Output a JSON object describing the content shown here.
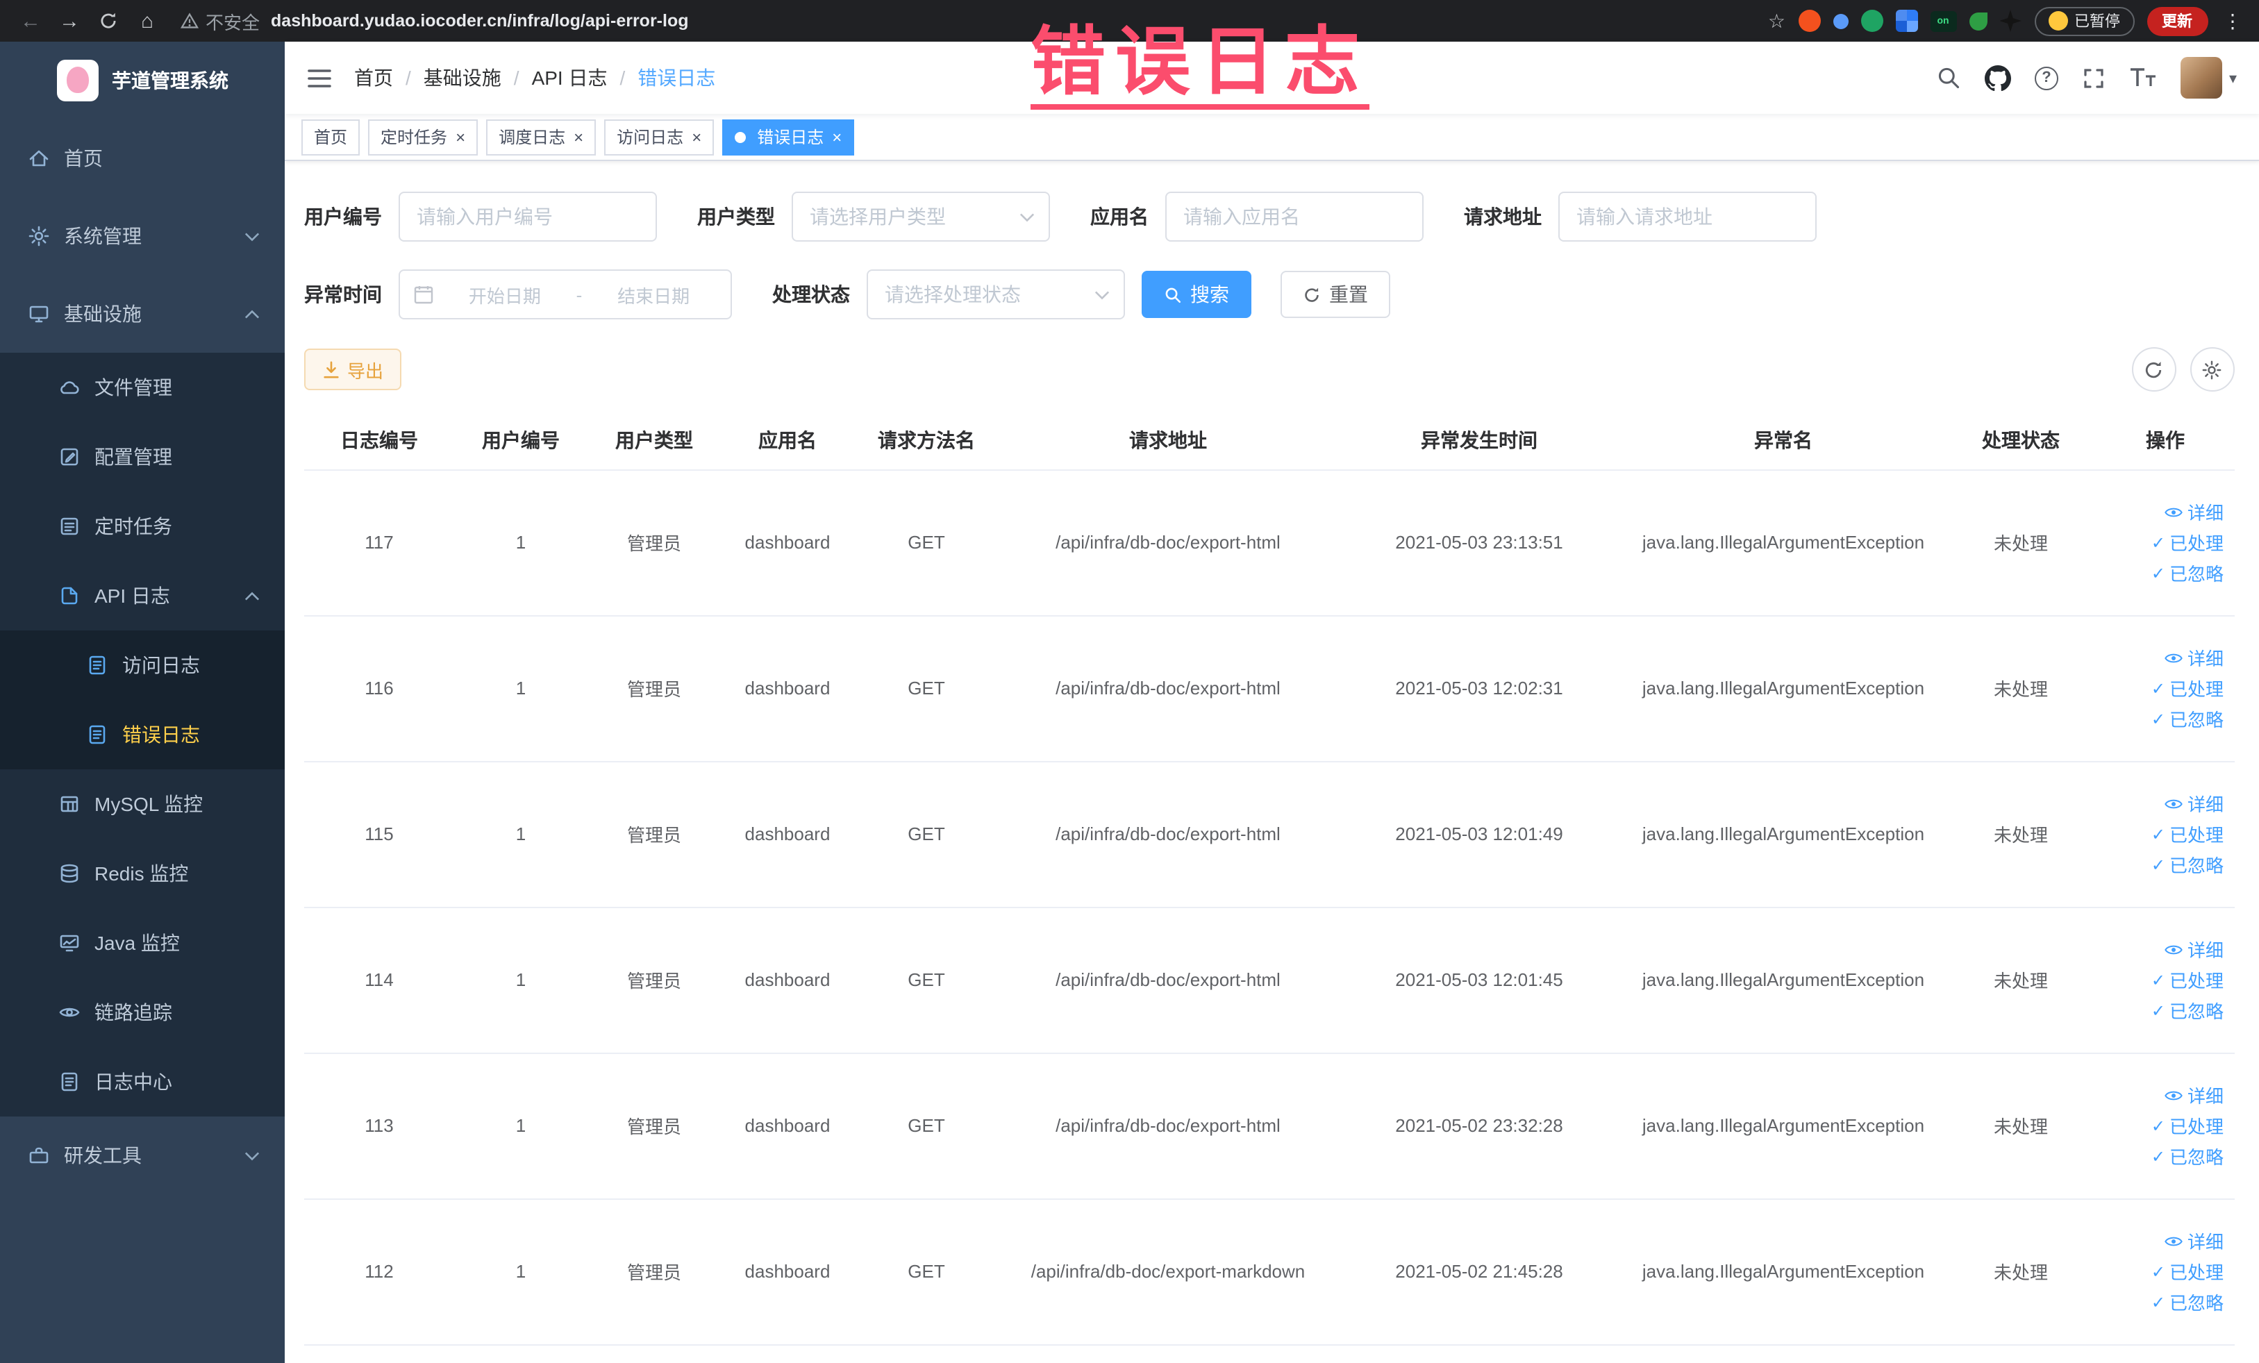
{
  "browser": {
    "security_label": "不安全",
    "url": "dashboard.yudao.iocoder.cn/infra/log/api-error-log",
    "paused_label": "已暂停",
    "update_label": "更新",
    "extension_on_label": "on"
  },
  "icons": {
    "back": "←",
    "forward": "→",
    "home": "⌂",
    "star": "☆",
    "kebab": "⋮",
    "caret_down": "▾",
    "close": "×",
    "check": "✓",
    "help": "?"
  },
  "annotation": {
    "text": "错误日志"
  },
  "sidebar": {
    "title": "芋道管理系统",
    "items": [
      {
        "label": "首页"
      },
      {
        "label": "系统管理"
      },
      {
        "label": "基础设施"
      },
      {
        "label": "文件管理"
      },
      {
        "label": "配置管理"
      },
      {
        "label": "定时任务"
      },
      {
        "label": "API 日志"
      },
      {
        "label": "访问日志"
      },
      {
        "label": "错误日志"
      },
      {
        "label": "MySQL 监控"
      },
      {
        "label": "Redis 监控"
      },
      {
        "label": "Java 监控"
      },
      {
        "label": "链路追踪"
      },
      {
        "label": "日志中心"
      },
      {
        "label": "研发工具"
      }
    ]
  },
  "navbar": {
    "separator": "/",
    "breadcrumb": [
      {
        "label": "首页"
      },
      {
        "label": "基础设施"
      },
      {
        "label": "API 日志"
      },
      {
        "label": "错误日志"
      }
    ]
  },
  "tabs": [
    {
      "label": "首页"
    },
    {
      "label": "定时任务"
    },
    {
      "label": "调度日志"
    },
    {
      "label": "访问日志"
    },
    {
      "label": "错误日志"
    }
  ],
  "filters": {
    "user_id": {
      "label": "用户编号",
      "placeholder": "请输入用户编号"
    },
    "user_type": {
      "label": "用户类型",
      "placeholder": "请选择用户类型"
    },
    "app_name": {
      "label": "应用名",
      "placeholder": "请输入应用名"
    },
    "request_url": {
      "label": "请求地址",
      "placeholder": "请输入请求地址"
    },
    "exception_time": {
      "label": "异常时间",
      "start_placeholder": "开始日期",
      "separator": "-",
      "end_placeholder": "结束日期"
    },
    "process_status": {
      "label": "处理状态",
      "placeholder": "请选择处理状态"
    },
    "search_label": "搜索",
    "reset_label": "重置"
  },
  "toolbar": {
    "export_label": "导出"
  },
  "table": {
    "headers": [
      "日志编号",
      "用户编号",
      "用户类型",
      "应用名",
      "请求方法名",
      "请求地址",
      "异常发生时间",
      "异常名",
      "处理状态",
      "操作"
    ],
    "action_labels": {
      "detail": "详细",
      "processed": "已处理",
      "ignored": "已忽略"
    },
    "rows": [
      {
        "log_id": "117",
        "user_id": "1",
        "user_type": "管理员",
        "app_name": "dashboard",
        "method": "GET",
        "request_url": "/api/infra/db-doc/export-html",
        "time": "2021-05-03 23:13:51",
        "exception": "java.lang.IllegalArgumentException",
        "status": "未处理"
      },
      {
        "log_id": "116",
        "user_id": "1",
        "user_type": "管理员",
        "app_name": "dashboard",
        "method": "GET",
        "request_url": "/api/infra/db-doc/export-html",
        "time": "2021-05-03 12:02:31",
        "exception": "java.lang.IllegalArgumentException",
        "status": "未处理"
      },
      {
        "log_id": "115",
        "user_id": "1",
        "user_type": "管理员",
        "app_name": "dashboard",
        "method": "GET",
        "request_url": "/api/infra/db-doc/export-html",
        "time": "2021-05-03 12:01:49",
        "exception": "java.lang.IllegalArgumentException",
        "status": "未处理"
      },
      {
        "log_id": "114",
        "user_id": "1",
        "user_type": "管理员",
        "app_name": "dashboard",
        "method": "GET",
        "request_url": "/api/infra/db-doc/export-html",
        "time": "2021-05-03 12:01:45",
        "exception": "java.lang.IllegalArgumentException",
        "status": "未处理"
      },
      {
        "log_id": "113",
        "user_id": "1",
        "user_type": "管理员",
        "app_name": "dashboard",
        "method": "GET",
        "request_url": "/api/infra/db-doc/export-html",
        "time": "2021-05-02 23:32:28",
        "exception": "java.lang.IllegalArgumentException",
        "status": "未处理"
      },
      {
        "log_id": "112",
        "user_id": "1",
        "user_type": "管理员",
        "app_name": "dashboard",
        "method": "GET",
        "request_url": "/api/infra/db-doc/export-markdown",
        "time": "2021-05-02 21:45:28",
        "exception": "java.lang.IllegalArgumentException",
        "status": "未处理"
      }
    ]
  }
}
